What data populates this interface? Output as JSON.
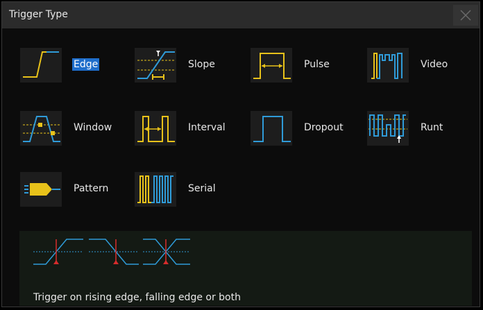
{
  "dialog": {
    "title": "Trigger Type",
    "close_icon": "close-icon"
  },
  "trigger_types": [
    {
      "label": "Edge",
      "icon": "edge-trigger-icon",
      "selected": true
    },
    {
      "label": "Slope",
      "icon": "slope-trigger-icon",
      "selected": false
    },
    {
      "label": "Pulse",
      "icon": "pulse-trigger-icon",
      "selected": false
    },
    {
      "label": "Video",
      "icon": "video-trigger-icon",
      "selected": false
    },
    {
      "label": "Window",
      "icon": "window-trigger-icon",
      "selected": false
    },
    {
      "label": "Interval",
      "icon": "interval-trigger-icon",
      "selected": false
    },
    {
      "label": "Dropout",
      "icon": "dropout-trigger-icon",
      "selected": false
    },
    {
      "label": "Runt",
      "icon": "runt-trigger-icon",
      "selected": false
    },
    {
      "label": "Pattern",
      "icon": "pattern-trigger-icon",
      "selected": false
    },
    {
      "label": "Serial",
      "icon": "serial-trigger-icon",
      "selected": false
    }
  ],
  "description": {
    "text": "Trigger on rising edge, falling edge or both",
    "illustration": "edge-modes-illustration"
  },
  "colors": {
    "signal_yellow": "#e8c21a",
    "signal_blue": "#2f9bd8",
    "trigger_red": "#d62c2c",
    "selection_blue": "#1f6ecb"
  }
}
